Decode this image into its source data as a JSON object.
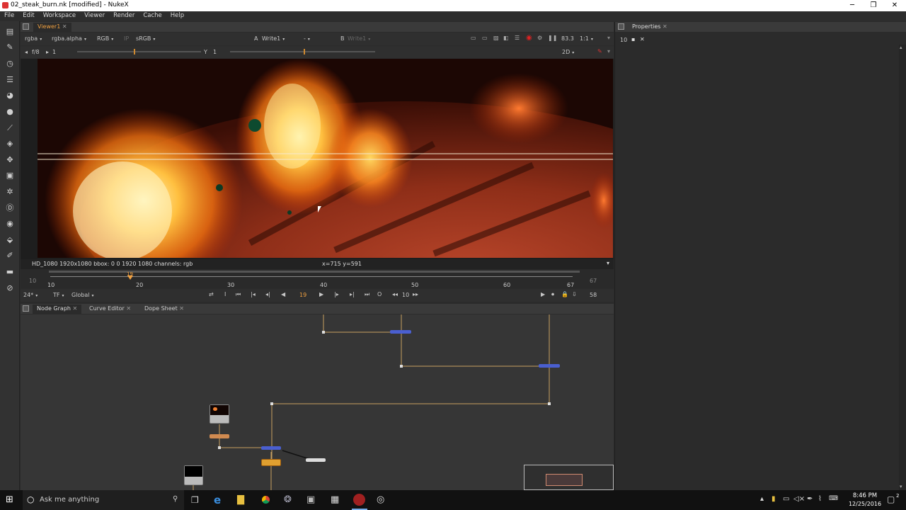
{
  "window": {
    "title": "02_steak_burn.nk [modified] - NukeX",
    "controls": [
      "minimize-icon",
      "maximize-icon",
      "close-icon"
    ]
  },
  "menu": [
    "File",
    "Edit",
    "Workspace",
    "Viewer",
    "Render",
    "Cache",
    "Help"
  ],
  "viewer": {
    "tab": "Viewer1",
    "channels": "rgba",
    "alpha": "rgba.alpha",
    "display": "RGB",
    "lut": "sRGB",
    "input_a": "Write1",
    "input_a_label": "A",
    "input_b_label": "B",
    "input_b": "Write1",
    "compare": "-",
    "zoom": "83.3",
    "ratio": "1:1",
    "fstop": "f/8",
    "gain": "1",
    "gamma_label": "Y",
    "gamma": "1",
    "mode": "2D",
    "status_left": "HD_1080 1920x1080  bbox: 0 0 1920 1080 channels: rgb",
    "coords": "x=715 y=591"
  },
  "timeline": {
    "range_start": "10",
    "range_end": "67",
    "ticks": [
      "10",
      "20",
      "30",
      "40",
      "50",
      "60",
      "67"
    ],
    "current_frame": "19",
    "current_marker": "19",
    "fps": "24*",
    "tf": "TF",
    "scope": "Global",
    "increment": "10",
    "end_frame": "58",
    "in_label": "I",
    "out_label": "O"
  },
  "properties": {
    "tab": "Properties",
    "count": "10"
  },
  "bottom_tabs": [
    "Node Graph",
    "Curve Editor",
    "Dope Sheet"
  ],
  "taskbar": {
    "search_placeholder": "Ask me anything",
    "time": "8:46 PM",
    "date": "12/25/2016",
    "notification_count": "2"
  },
  "colors": {
    "accent": "#f0a040",
    "node_blue": "#4a5fd0",
    "node_orange": "#e0a030",
    "wire": "#c8a060"
  }
}
